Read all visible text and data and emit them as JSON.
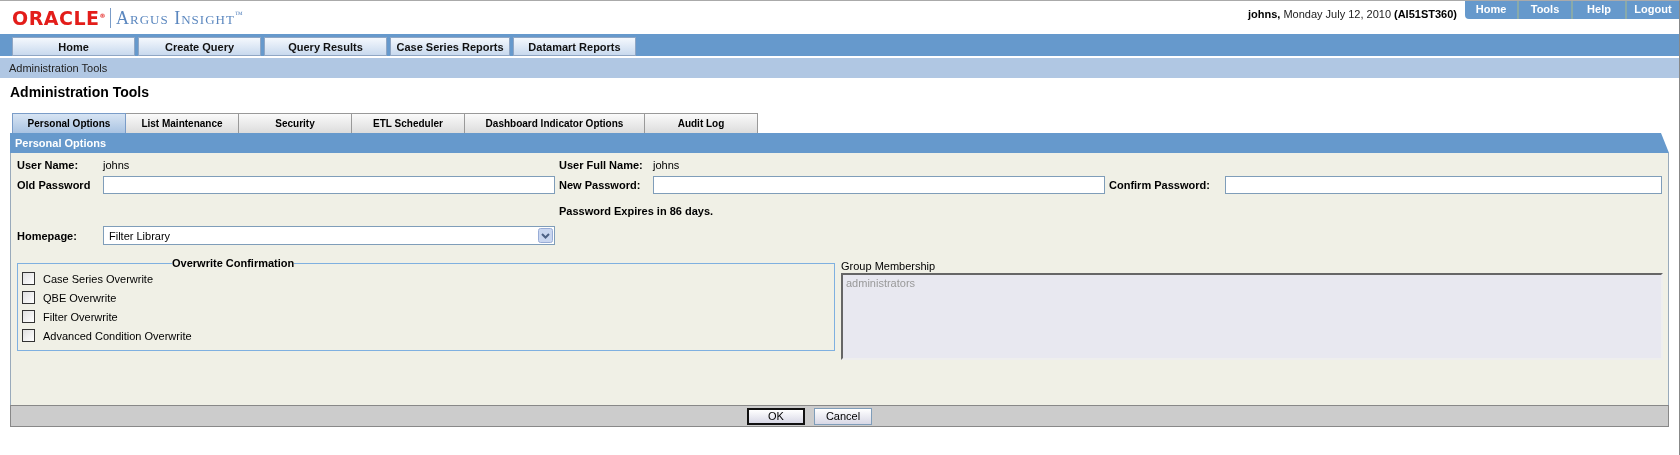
{
  "header": {
    "logo": "ORACLE",
    "logo_mark": "®",
    "product": "Argus Insight",
    "product_mark": "™",
    "user": "johns,",
    "date": "Monday July 12, 2010",
    "server": "(AI51ST360)"
  },
  "top_links": [
    "Home",
    "Tools",
    "Help",
    "Logout"
  ],
  "nav": [
    "Home",
    "Create Query",
    "Query Results",
    "Case Series Reports",
    "Datamart Reports"
  ],
  "breadcrumb": "Administration Tools",
  "page_title": "Administration Tools",
  "tabs": [
    {
      "label": "Personal Options",
      "selected": true
    },
    {
      "label": "List Maintenance",
      "selected": false
    },
    {
      "label": "Security",
      "selected": false
    },
    {
      "label": "ETL Scheduler",
      "selected": false
    },
    {
      "label": "Dashboard Indicator Options",
      "selected": false
    },
    {
      "label": "Audit Log",
      "selected": false
    }
  ],
  "panel": {
    "title": "Personal Options",
    "user_name": {
      "label": "User Name:",
      "value": "johns"
    },
    "user_full_name": {
      "label": "User Full Name:",
      "value": "johns"
    },
    "old_password": {
      "label": "Old Password"
    },
    "new_password": {
      "label": "New Password:"
    },
    "confirm_password": {
      "label": "Confirm Password:"
    },
    "password_note": "Password Expires in 86 days.",
    "homepage": {
      "label": "Homepage:",
      "value": "Filter Library"
    },
    "overwrite": {
      "legend": "Overwrite Confirmation",
      "options": [
        {
          "label": "Case Series Overwrite",
          "checked": false
        },
        {
          "label": "QBE Overwrite",
          "checked": false
        },
        {
          "label": "Filter Overwrite",
          "checked": false
        },
        {
          "label": "Advanced Condition Overwrite",
          "checked": false
        }
      ]
    },
    "group_membership": {
      "label": "Group Membership",
      "items": [
        "administrators"
      ]
    }
  },
  "buttons": [
    {
      "label": "OK",
      "kind": "default"
    },
    {
      "label": "Cancel",
      "kind": "normal"
    }
  ]
}
